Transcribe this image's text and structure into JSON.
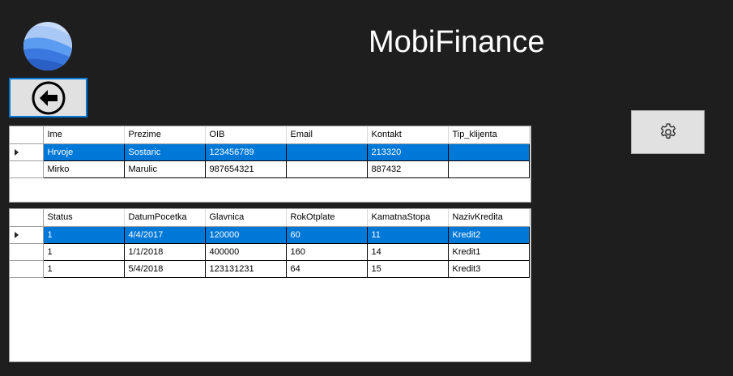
{
  "app": {
    "title": "MobiFinance"
  },
  "icons": {
    "logo": "google-earth-logo-icon",
    "back": "back-arrow-icon",
    "settings": "gear-icon"
  },
  "colors": {
    "background": "#1e1e1e",
    "selection": "#0078d7",
    "button": "#e1e1e1"
  },
  "clients_grid": {
    "columns": [
      "Ime",
      "Prezime",
      "OIB",
      "Email",
      "Kontakt",
      "Tip_klijenta"
    ],
    "rows": [
      {
        "selected": true,
        "cells": [
          "Hrvoje",
          "Sostaric",
          "123456789",
          "",
          "213320",
          ""
        ]
      },
      {
        "selected": false,
        "cells": [
          "Mirko",
          "Marulic",
          "987654321",
          "",
          "887432",
          ""
        ]
      }
    ]
  },
  "loans_grid": {
    "columns": [
      "Status",
      "DatumPocetka",
      "Glavnica",
      "RokOtplate",
      "KamatnaStopa",
      "NazivKredita"
    ],
    "rows": [
      {
        "selected": true,
        "cells": [
          "1",
          "4/4/2017",
          "120000",
          "60",
          "11",
          "Kredit2"
        ]
      },
      {
        "selected": false,
        "cells": [
          "1",
          "1/1/2018",
          "400000",
          "160",
          "14",
          "Kredit1"
        ]
      },
      {
        "selected": false,
        "cells": [
          "1",
          "5/4/2018",
          "123131231",
          "64",
          "15",
          "Kredit3"
        ]
      }
    ]
  }
}
